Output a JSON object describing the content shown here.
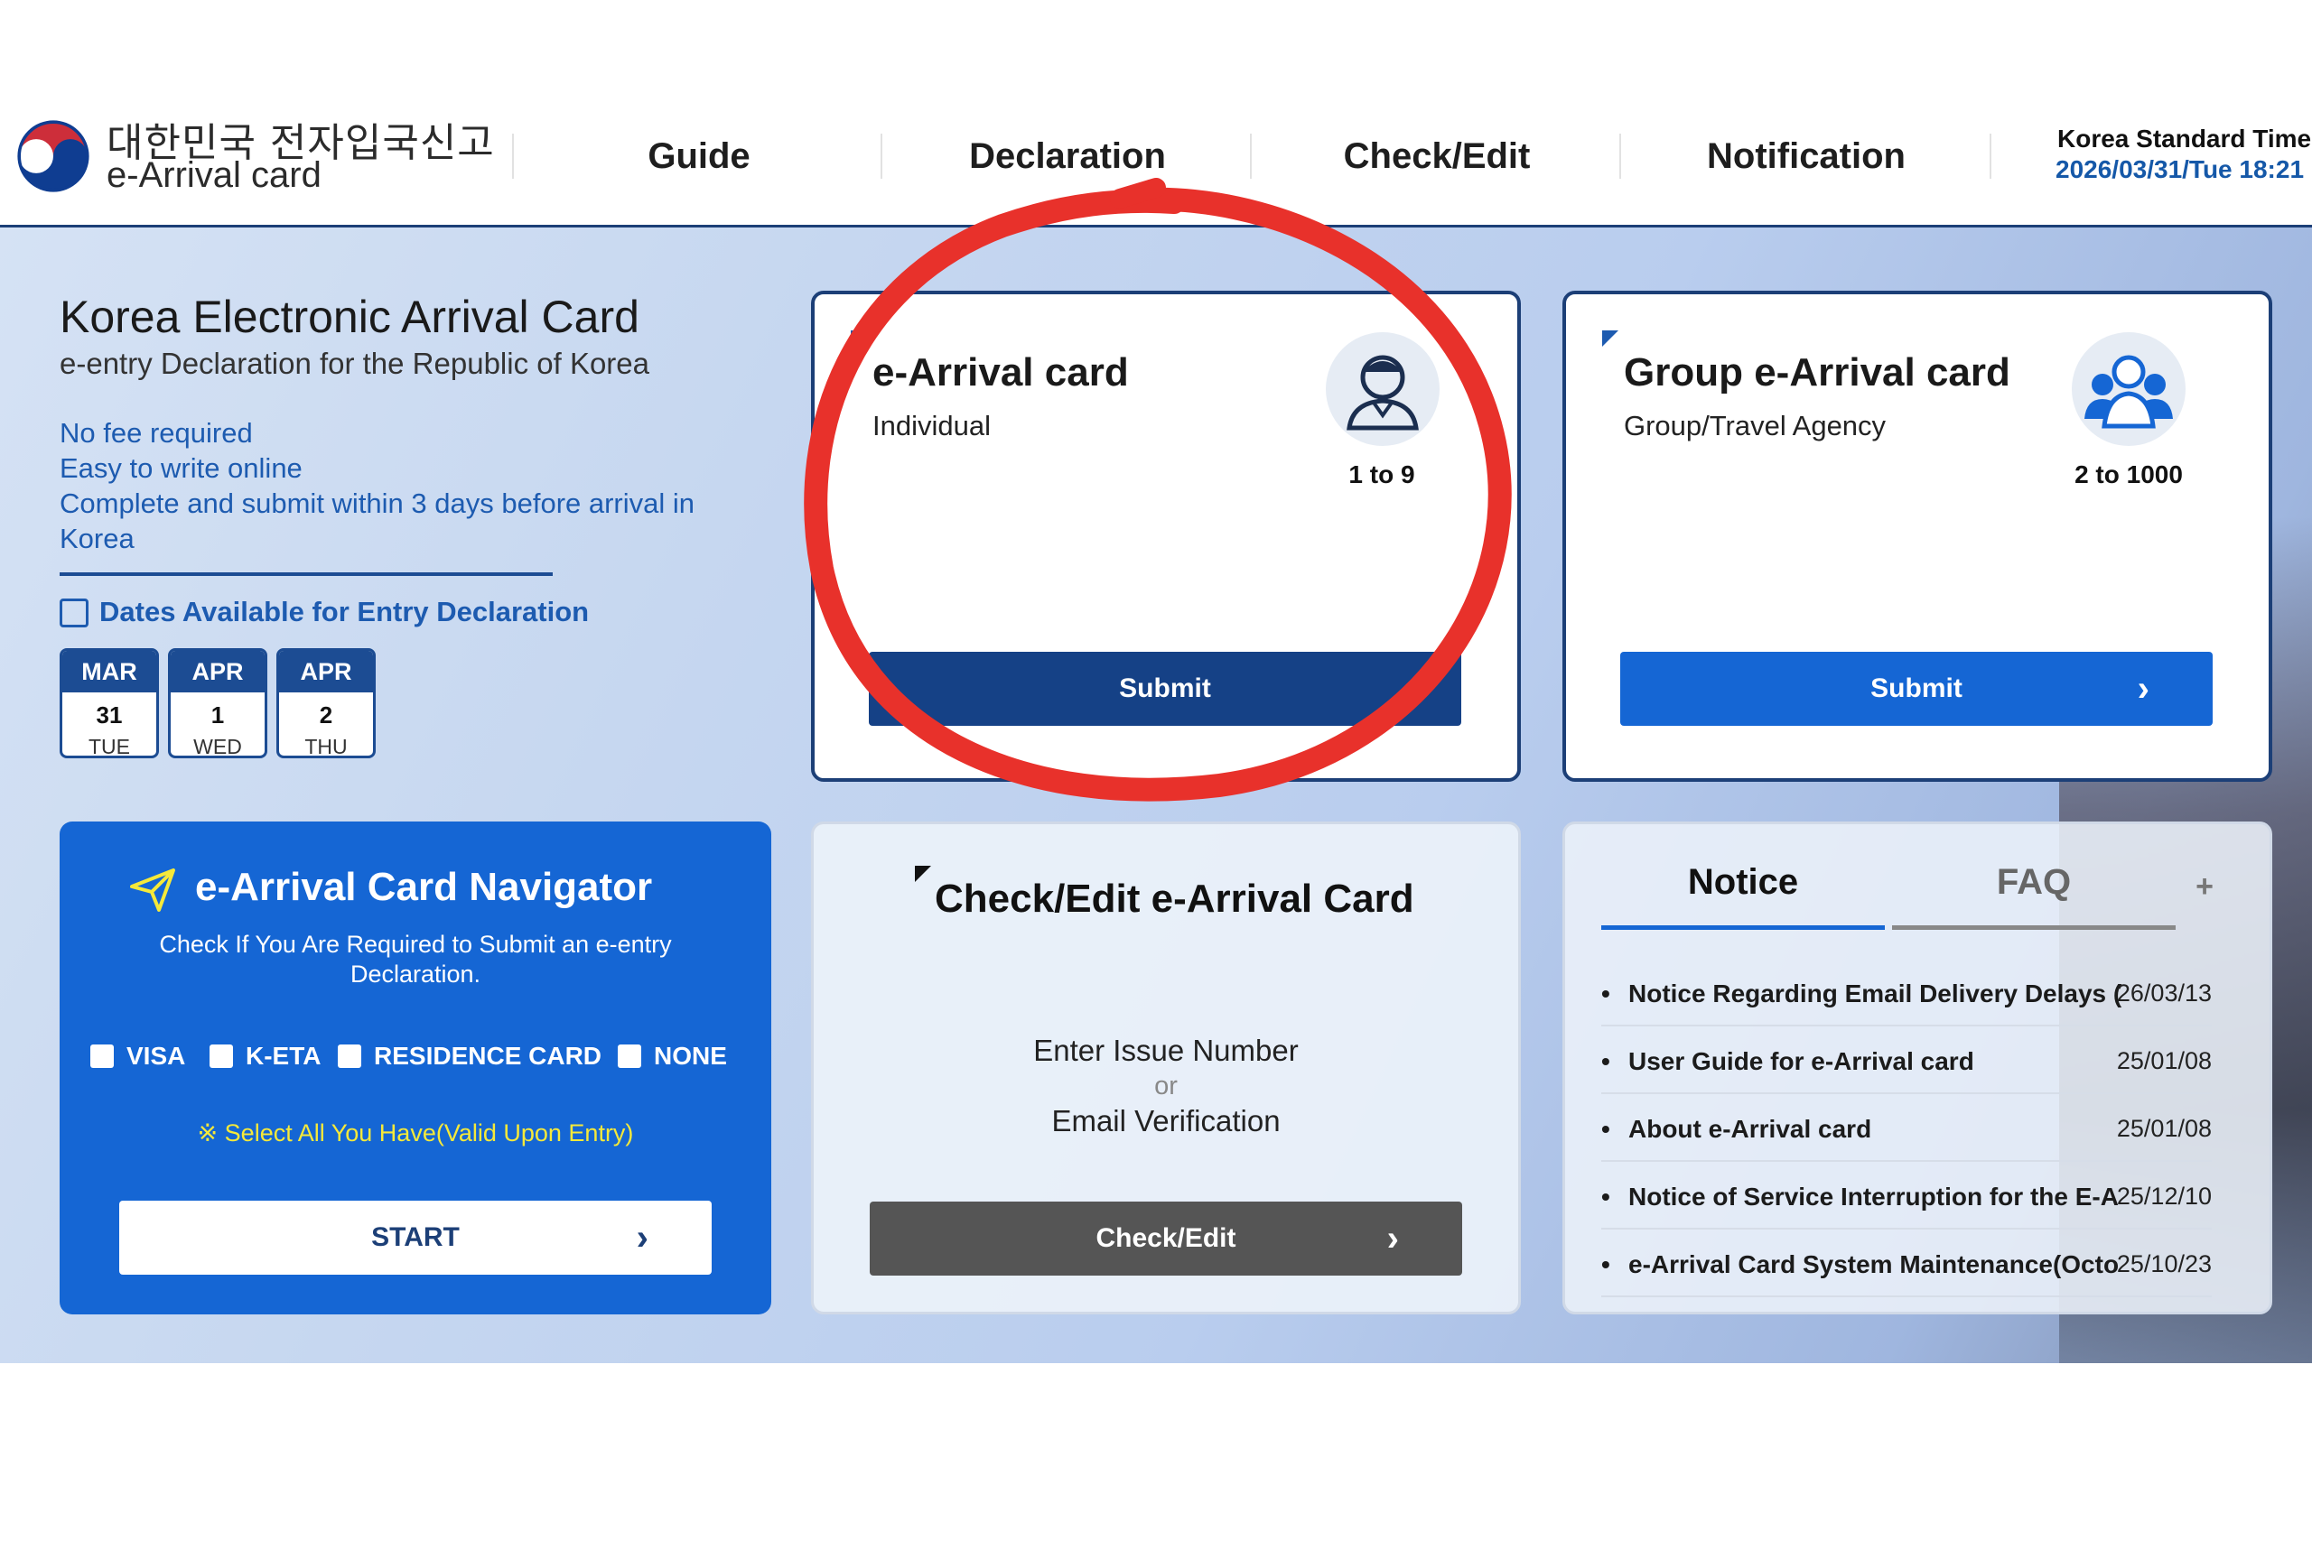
{
  "header": {
    "brand_kr": "대한민국 전자입국신고",
    "brand_en": "e-Arrival card",
    "nav": [
      "Guide",
      "Declaration",
      "Check/Edit",
      "Notification"
    ],
    "time_label": "Korea Standard Time",
    "time_value": "2026/03/31/Tue 18:21"
  },
  "intro": {
    "title": "Korea Electronic Arrival Card",
    "subtitle": "e-entry Declaration for the Republic of Korea",
    "points": [
      "No fee required",
      "Easy to write online",
      "Complete and submit within 3 days before arrival in Korea"
    ],
    "dates_title": "Dates Available for Entry Declaration",
    "dates": [
      {
        "month": "MAR",
        "day": "31",
        "weekday": "TUE"
      },
      {
        "month": "APR",
        "day": "1",
        "weekday": "WED"
      },
      {
        "month": "APR",
        "day": "2",
        "weekday": "THU"
      }
    ]
  },
  "individual_card": {
    "title": "e-Arrival card",
    "subtitle": "Individual",
    "range": "1 to 9",
    "button": "Submit"
  },
  "group_card": {
    "title": "Group e-Arrival card",
    "subtitle": "Group/Travel Agency",
    "range": "2 to 1000",
    "button": "Submit"
  },
  "navigator": {
    "title": "e-Arrival Card Navigator",
    "description": "Check If You Are Required to Submit an e-entry Declaration.",
    "options": [
      "VISA",
      "K-ETA",
      "RESIDENCE CARD",
      "NONE"
    ],
    "hint": "※ Select All You Have(Valid Upon Entry)",
    "button": "START"
  },
  "check_edit": {
    "title": "Check/Edit e-Arrival Card",
    "line1": "Enter Issue Number",
    "or": "or",
    "line2": "Email Verification",
    "button": "Check/Edit"
  },
  "notice": {
    "tabs": [
      "Notice",
      "FAQ"
    ],
    "more": "+",
    "items": [
      {
        "title": "Notice Regarding Email Delivery Delays (",
        "date": "26/03/13"
      },
      {
        "title": "User Guide for e-Arrival card",
        "date": "25/01/08"
      },
      {
        "title": "About e-Arrival card",
        "date": "25/01/08"
      },
      {
        "title": "Notice of Service Interruption for the E-A",
        "date": "25/12/10"
      },
      {
        "title": "e-Arrival Card System Maintenance(Octo",
        "date": "25/10/23"
      }
    ]
  },
  "colors": {
    "navy": "#1c3f77",
    "blue": "#1566d4",
    "link_blue": "#1d5bb0",
    "annotation_red": "#e8312b",
    "hint_yellow": "#f5e93a",
    "checkedit_button": "#555555"
  }
}
